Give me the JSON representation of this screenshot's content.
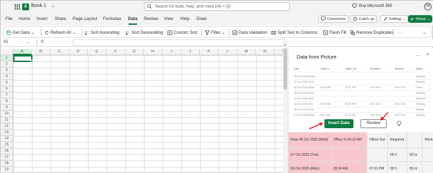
{
  "app": {
    "logo_letter": "X",
    "book_name": "Book 1",
    "search_placeholder": "Search for tools, help, and more (Alt + Q)",
    "buy_label": "Buy Microsoft 365",
    "avatar_initials": "ZB"
  },
  "menu": {
    "items": [
      "File",
      "Home",
      "Insert",
      "Share",
      "Page Layout",
      "Formulas",
      "Data",
      "Review",
      "View",
      "Help",
      "Draw"
    ],
    "active": "Data",
    "comments_label": "Comments",
    "catchup_label": "Catch up",
    "editing_label": "Editing",
    "share_label": "Share"
  },
  "ribbon": {
    "get_data": "Get Data",
    "refresh_all": "Refresh All",
    "sort_ascending": "Sort Ascending",
    "sort_descending": "Sort Descending",
    "custom_sort": "Custom Sort",
    "filter": "Filter",
    "data_validation": "Data Validation",
    "split_text": "Split Text to Columns",
    "flash_fill": "Flash Fill",
    "remove_duplicates": "Remove Duplicates",
    "more": "···"
  },
  "formula_bar": {
    "name_box": "A1",
    "fx": "fx",
    "value": ""
  },
  "grid": {
    "columns": [
      "A",
      "B",
      "C",
      "D",
      "E",
      "F",
      "G",
      "H",
      "I",
      "J",
      "K",
      "L",
      "M",
      "N",
      "O"
    ],
    "rows": [
      "1",
      "2",
      "3",
      "4",
      "5",
      "6",
      "7",
      "8",
      "9",
      "10",
      "11",
      "12",
      "13",
      "14",
      "15",
      "16",
      "17",
      "18",
      "19"
    ],
    "selected_col": "A",
    "selected_row": "1"
  },
  "pane": {
    "title": "Data from Picture",
    "more": "···",
    "close": "×",
    "preview_headers": [
      "Date",
      "Office In",
      "Office Out",
      "Required",
      "Worked",
      "Status"
    ],
    "preview_rows": [
      [
        "08 Oct 2025 (Wed)",
        "",
        "",
        "",
        "",
        "Working"
      ],
      [
        "07 Oct 2025 (Tue)",
        "",
        "",
        "",
        "",
        "Working"
      ],
      [
        "06 Oct 2025 (Mon)",
        "09:34 AM",
        "07:01 PM",
        "09 h 00 m",
        "09 h 27 m",
        "Leave"
      ],
      [
        "05 Oct 2025 (Sun)",
        "",
        "",
        "",
        "",
        "Working"
      ],
      [
        "04 Oct 2025 (Sat)",
        "",
        "",
        "",
        "",
        "Weekend"
      ],
      [
        "03 Oct 2025 (Fri)",
        "09:30 AM",
        "06:45 PM",
        "09 h 00 m",
        "09 h 15 m",
        "Working"
      ],
      [
        "02 Oct 2025 (Thu)",
        "",
        "",
        "",
        "",
        "Holiday"
      ],
      [
        "01 Oct 2025 (Wed)",
        "09:41 AM",
        "07:12 PM",
        "09 h 00 m",
        "09 h 31 m",
        "Working"
      ],
      [
        "30 Sep 2025 (Tue)",
        "09:28 AM",
        "06:58 PM",
        "09 h 00 m",
        "09 h 30 m",
        "Working"
      ]
    ],
    "insert_label": "Insert Data",
    "review_label": "Review",
    "table_header": [
      "Date 08 Oct 2025 (Wed)",
      "Office In 09:13 AM",
      "Office Out",
      "Required",
      "",
      "Worke"
    ],
    "table_rows": [
      [
        "07 Oct 2025 (Tue)",
        "",
        "",
        "09 h",
        "00 m",
        ""
      ],
      [
        "06 Oct 2025 (Mon)",
        "09:34 AM",
        "07:01 PM",
        "09 h",
        "00 m",
        ""
      ]
    ]
  },
  "colors": {
    "accent": "#107c41",
    "pink": "#f8c7cd",
    "arrow": "#e81123"
  }
}
